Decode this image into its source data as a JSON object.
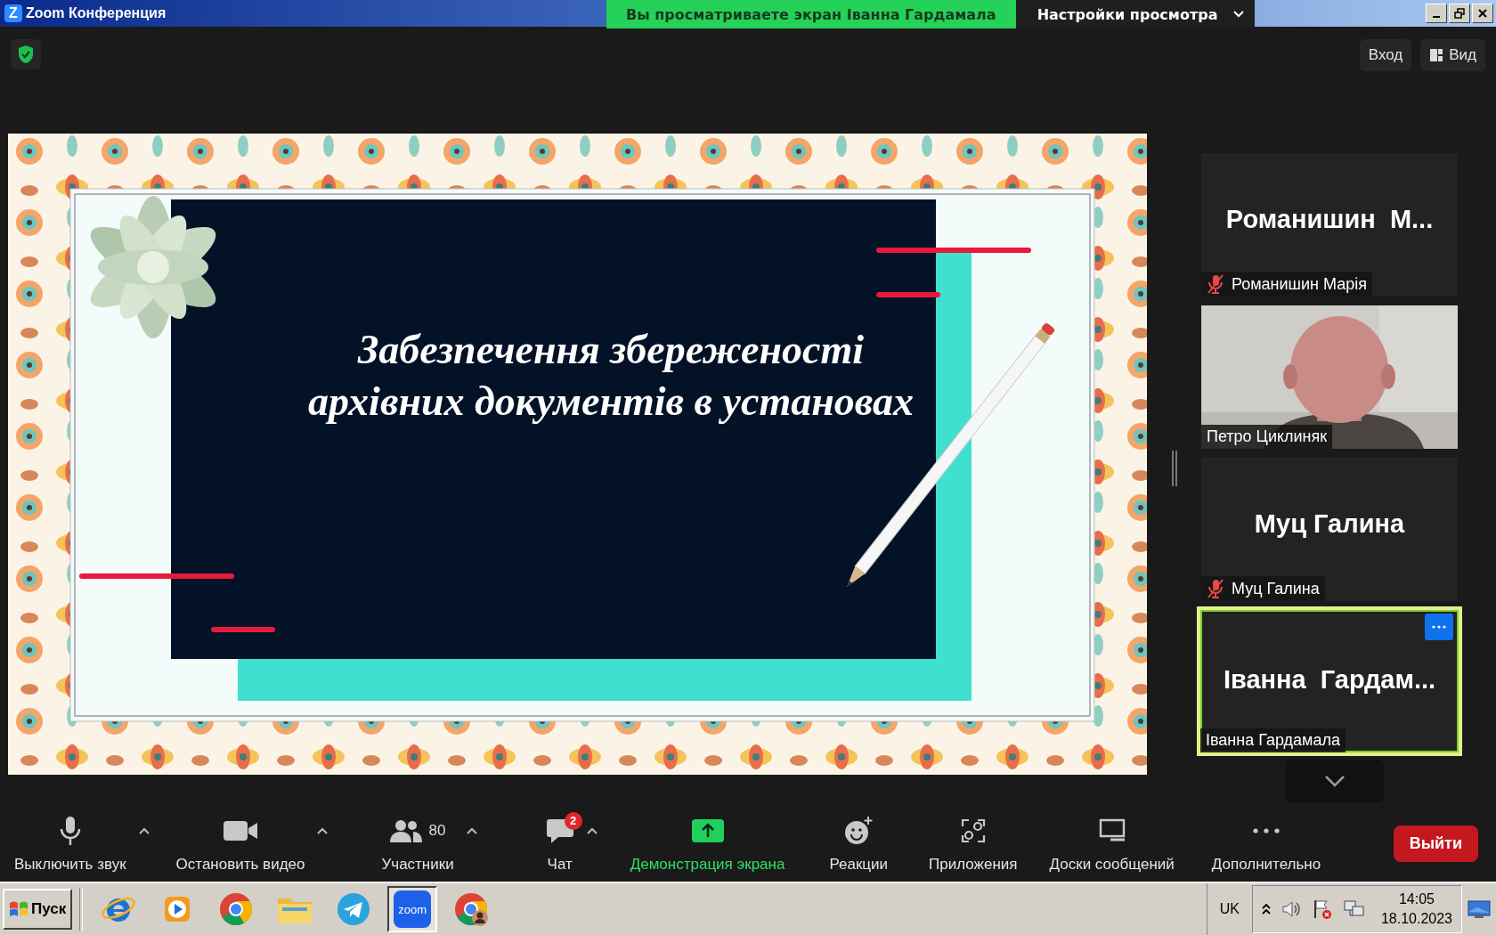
{
  "window": {
    "logo": "Z",
    "title": "Zoom Конференция"
  },
  "share_banner": {
    "text": "Вы просматриваете экран Іванна Гардамала",
    "view_settings": "Настройки просмотра"
  },
  "top_buttons": [
    {
      "kind": "signin",
      "label": "Вход"
    },
    {
      "kind": "view",
      "label": "Вид"
    }
  ],
  "slide": {
    "title_lines": [
      "Забезпечення збереженості",
      "архівних документів в установах"
    ]
  },
  "participants": [
    {
      "kind": "name",
      "big_name": "Романишин  М...",
      "label": "Романишин Марія",
      "muted": true,
      "active_speaker": false,
      "show_options": false
    },
    {
      "kind": "video",
      "label": "Петро Циклиняк",
      "muted": false,
      "active_speaker": false,
      "show_options": false
    },
    {
      "kind": "name",
      "big_name": "Муц Галина",
      "label": "Муц Галина",
      "muted": true,
      "active_speaker": false,
      "show_options": false
    },
    {
      "kind": "name",
      "big_name": "Іванна  Гардам...",
      "label": "Іванна Гардамала",
      "muted": false,
      "active_speaker": true,
      "show_options": true
    }
  ],
  "toolbar": [
    {
      "kind": "mic",
      "label": "Выключить звук",
      "caret": true,
      "active": false
    },
    {
      "kind": "camera",
      "label": "Остановить видео",
      "caret": true,
      "active": false
    },
    {
      "kind": "people",
      "label": "Участники",
      "count": "80",
      "caret": true,
      "active": false
    },
    {
      "kind": "chat",
      "label": "Чат",
      "badge": "2",
      "caret": true,
      "active": false
    },
    {
      "kind": "share",
      "label": "Демонстрация экрана",
      "caret": false,
      "active": true
    },
    {
      "kind": "reactions",
      "label": "Реакции",
      "caret": false,
      "active": false
    },
    {
      "kind": "apps",
      "label": "Приложения",
      "caret": false,
      "active": false
    },
    {
      "kind": "whiteboard",
      "label": "Доски сообщений",
      "caret": false,
      "active": false
    },
    {
      "kind": "more",
      "label": "Дополнительно",
      "caret": false,
      "active": false
    }
  ],
  "leave_button": "Выйти",
  "taskbar": {
    "start": "Пуск",
    "apps": [
      {
        "kind": "ie",
        "selected": false
      },
      {
        "kind": "media",
        "selected": false
      },
      {
        "kind": "chrome",
        "selected": false
      },
      {
        "kind": "explorer",
        "selected": false
      },
      {
        "kind": "telegram",
        "selected": false
      },
      {
        "kind": "zoom",
        "logo_text": "zoom",
        "selected": true
      },
      {
        "kind": "chrome-profile",
        "selected": false
      }
    ],
    "language": "UK",
    "time": "14:05",
    "date": "18.10.2023"
  }
}
